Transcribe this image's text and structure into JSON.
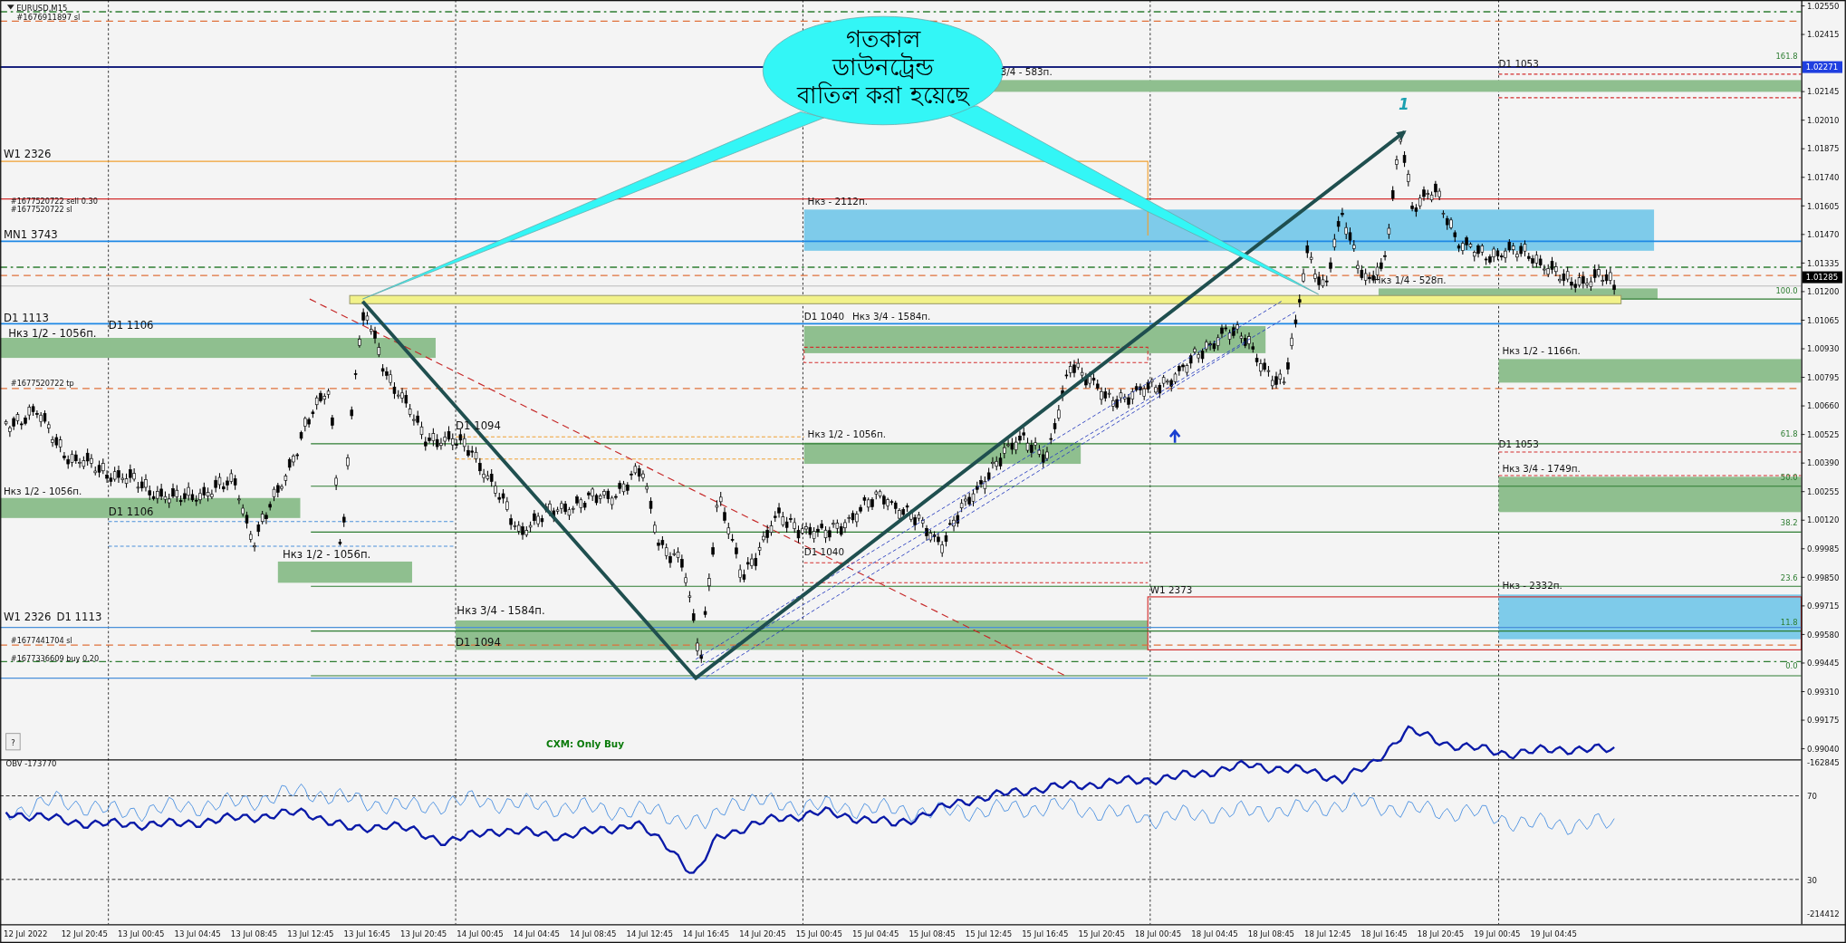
{
  "chart": {
    "symbol": "EURUSD,M15",
    "overlay_text": "#1676911897 sl",
    "labels": [
      {
        "text": "W1 2326"
      },
      {
        "text": "#1677520722 sell 0.30"
      },
      {
        "text": "#1677520722 sl"
      },
      {
        "text": "MN1 3743"
      },
      {
        "text": "D1 1113"
      },
      {
        "text": "D1 1106"
      },
      {
        "text": "Нкз 1/2 - 1056п."
      },
      {
        "text": "#1677520722 tp"
      },
      {
        "text": "Нкз 1/2 - 1056п."
      },
      {
        "text": "D1 1106"
      },
      {
        "text": "Нкз 1/2 - 1056п."
      },
      {
        "text": "D1 1094"
      },
      {
        "text": "Нкз 3/4 - 1584п."
      },
      {
        "text": "D1 1094"
      },
      {
        "text": "W1 2326"
      },
      {
        "text": "D1 1113"
      },
      {
        "text": "#1677441704 sl"
      },
      {
        "text": "#1677336609 buy 0.20"
      },
      {
        "text": "Нкз - 2112п."
      },
      {
        "text": "3/4 - 583п."
      },
      {
        "text": "D1 1040"
      },
      {
        "text": "Нкз 3/4 - 1584п."
      },
      {
        "text": "Нкз 1/2 - 1056п."
      },
      {
        "text": "D1 1040"
      },
      {
        "text": "Нкз 1/4 - 528п."
      },
      {
        "text": "W1 2373"
      },
      {
        "text": "D1 1053"
      },
      {
        "text": "Нкз 1/2 - 1166п."
      },
      {
        "text": "D1 1053"
      },
      {
        "text": "Нкз 3/4 - 1749п."
      },
      {
        "text": "Нкз - 2332п."
      }
    ],
    "fib_levels": [
      "161.8",
      "100.0",
      "61.8",
      "50.0",
      "38.2",
      "23.6",
      "11.8",
      "0.0"
    ],
    "callout": {
      "lines": [
        "গতকাল",
        "ডাউনট্রেন্ড",
        "বাতিল করা হয়েছে"
      ]
    },
    "wave_label": "1",
    "footer_note": "CXM: Only Buy",
    "help_button": "?"
  },
  "price_axis": {
    "ticks": [
      "1.02550",
      "1.02415",
      "1.02145",
      "1.02010",
      "1.01875",
      "1.01740",
      "1.01605",
      "1.01470",
      "1.01335",
      "1.01200",
      "1.01065",
      "1.00930",
      "1.00795",
      "1.00660",
      "1.00525",
      "1.00390",
      "1.00255",
      "1.00120",
      "0.99985",
      "0.99850",
      "0.99715",
      "0.99580",
      "0.99445",
      "0.99310",
      "0.99175",
      "0.99040"
    ],
    "badges": [
      {
        "text": "1.02271",
        "kind": "level"
      },
      {
        "text": "1.01285",
        "kind": "bid"
      }
    ]
  },
  "indicator": {
    "title": "OBV -173770",
    "ticks": [
      "-162845",
      "70",
      "30",
      "-214412"
    ]
  },
  "time_axis": {
    "ticks": [
      "12 Jul 2022",
      "12 Jul 20:45",
      "13 Jul 00:45",
      "13 Jul 04:45",
      "13 Jul 08:45",
      "13 Jul 12:45",
      "13 Jul 16:45",
      "13 Jul 20:45",
      "14 Jul 00:45",
      "14 Jul 04:45",
      "14 Jul 08:45",
      "14 Jul 12:45",
      "14 Jul 16:45",
      "14 Jul 20:45",
      "15 Jul 00:45",
      "15 Jul 04:45",
      "15 Jul 08:45",
      "15 Jul 12:45",
      "15 Jul 16:45",
      "15 Jul 20:45",
      "18 Jul 00:45",
      "18 Jul 04:45",
      "18 Jul 08:45",
      "18 Jul 12:45",
      "18 Jul 16:45",
      "18 Jul 20:45",
      "19 Jul 00:45",
      "19 Jul 04:45"
    ]
  }
}
